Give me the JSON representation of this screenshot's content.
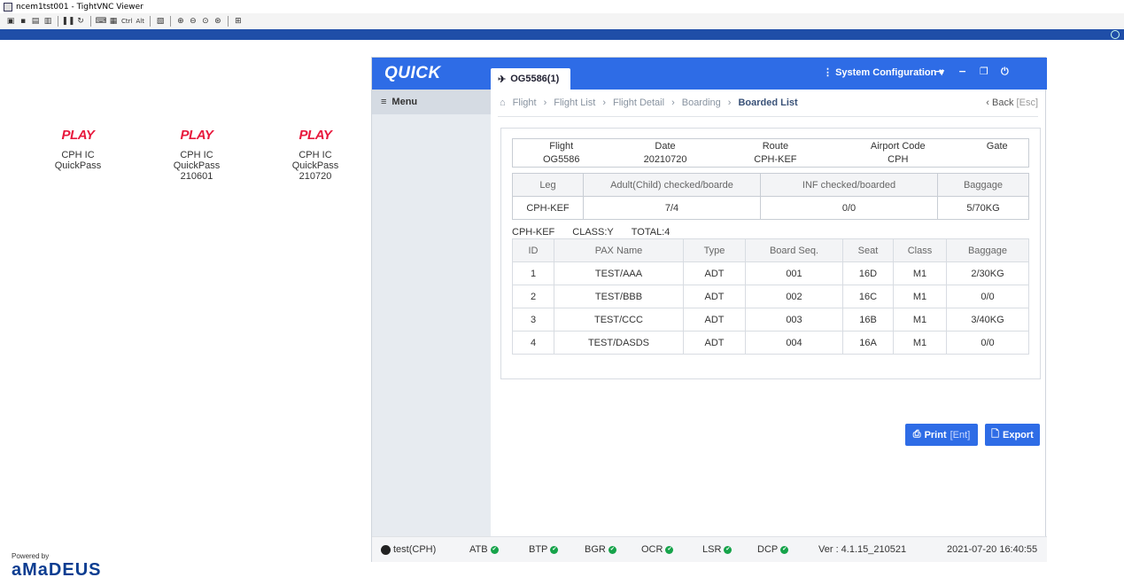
{
  "window": {
    "title": "ncem1tst001 - TightVNC Viewer"
  },
  "toolbar": {
    "ctrl_label": "Ctrl",
    "alt_label": "Alt"
  },
  "desktop": {
    "icons": [
      {
        "logo": "PLAY",
        "label": "CPH IC\nQuickPass"
      },
      {
        "logo": "PLAY",
        "label": "CPH IC\nQuickPass\n210601"
      },
      {
        "logo": "PLAY",
        "label": "CPH IC\nQuickPass\n210720"
      }
    ],
    "powered_by": "Powered by",
    "vendor": "aMaDEUS"
  },
  "app": {
    "brand": "QUICK",
    "tab_label": "OG5586(1)",
    "system_configuration": "System Configuration",
    "menu_label": "Menu",
    "breadcrumb": [
      "Flight",
      "Flight List",
      "Flight Detail",
      "Boarding",
      "Boarded List"
    ],
    "back_label": "Back",
    "back_key": "[Esc]",
    "flight_info": {
      "headers": [
        "Flight",
        "Date",
        "Route",
        "Airport Code",
        "Gate"
      ],
      "values": [
        "OG5586",
        "20210720",
        "CPH-KEF",
        "CPH",
        ""
      ]
    },
    "leg_table": {
      "headers": [
        "Leg",
        "Adult(Child) checked/boarde",
        "INF checked/boarded",
        "Baggage"
      ],
      "row": [
        "CPH-KEF",
        "7/4",
        "0/0",
        "5/70KG"
      ]
    },
    "summary": {
      "leg": "CPH-KEF",
      "class": "CLASS:Y",
      "total": "TOTAL:4"
    },
    "pax_table": {
      "headers": [
        "ID",
        "PAX Name",
        "Type",
        "Board Seq.",
        "Seat",
        "Class",
        "Baggage"
      ],
      "rows": [
        [
          "1",
          "TEST/AAA",
          "ADT",
          "001",
          "16D",
          "M1",
          "2/30KG"
        ],
        [
          "2",
          "TEST/BBB",
          "ADT",
          "002",
          "16C",
          "M1",
          "0/0"
        ],
        [
          "3",
          "TEST/CCC",
          "ADT",
          "003",
          "16B",
          "M1",
          "3/40KG"
        ],
        [
          "4",
          "TEST/DASDS",
          "ADT",
          "004",
          "16A",
          "M1",
          "0/0"
        ]
      ]
    },
    "print_label": "Print",
    "print_key": "[Ent]",
    "export_label": "Export",
    "status": {
      "user": "test(CPH)",
      "services": [
        "ATB",
        "BTP",
        "BGR",
        "OCR",
        "LSR",
        "DCP"
      ],
      "version": "Ver : 4.1.15_210521",
      "datetime": "2021-07-20  16:40:55"
    },
    "colors": {
      "header": "#2e6ce6",
      "ok": "#16a34a",
      "play": "#e8193d"
    }
  }
}
